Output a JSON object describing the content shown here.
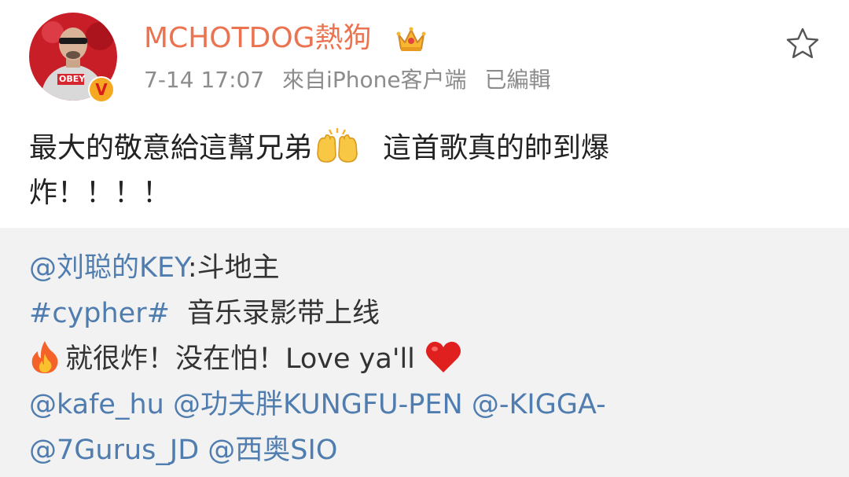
{
  "post": {
    "username": "MCHOTDOG熱狗",
    "timestamp": "7-14 17:07",
    "source": "來自iPhone客户端",
    "edited": "已編輯",
    "text_line1_a": "最大的敬意給這幫兄弟",
    "text_line1_b": "這首歌真的帥到爆",
    "text_line2": "炸！！！！",
    "avatar_shirt_text": "OBEY",
    "verified_badge": "V"
  },
  "retweet": {
    "author_mention": "@刘聪的KEY",
    "author_text": ":斗地主",
    "hashtag": "#cypher#",
    "hashtag_text": "音乐录影带上线",
    "line3_text": "就很炸！没在怕！Love ya'll",
    "mentions_line4": [
      "@kafe_hu",
      "@功夫胖KUNGFU-PEN",
      "@-KIGGA-"
    ],
    "mentions_line5": [
      "@7Gurus_JD",
      "@西奥SIO"
    ]
  },
  "icons": {
    "crown": "crown-icon",
    "star": "star-outline-icon",
    "hands": "raising-hands-emoji",
    "fire": "fire-emoji",
    "heart": "red-heart-emoji"
  },
  "colors": {
    "username": "#eb7350",
    "link": "#507daf",
    "meta": "#8c8c8c",
    "retweet_bg": "#f2f2f2",
    "badge": "#f7a823"
  }
}
